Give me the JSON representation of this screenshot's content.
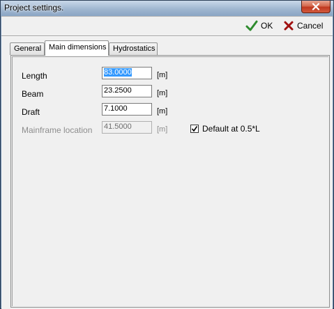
{
  "window": {
    "title": "Project settings."
  },
  "toolbar": {
    "ok_label": "OK",
    "cancel_label": "Cancel"
  },
  "tabs": [
    {
      "label": "General",
      "active": false
    },
    {
      "label": "Main dimensions",
      "active": true
    },
    {
      "label": "Hydrostatics",
      "active": false
    }
  ],
  "fields": {
    "length": {
      "label": "Length",
      "value": "83.0000",
      "unit": "[m]"
    },
    "beam": {
      "label": "Beam",
      "value": "23.2500",
      "unit": "[m]"
    },
    "draft": {
      "label": "Draft",
      "value": "7.1000",
      "unit": "[m]"
    },
    "mainframe": {
      "label": "Mainframe location",
      "value": "41.5000",
      "unit": "[m]",
      "enabled": false
    }
  },
  "checkbox": {
    "label": "Default at 0.5*L",
    "checked": true
  },
  "colors": {
    "ok_check": "#2e8b2e",
    "cancel_x": "#a01010",
    "selection": "#3399ff"
  }
}
